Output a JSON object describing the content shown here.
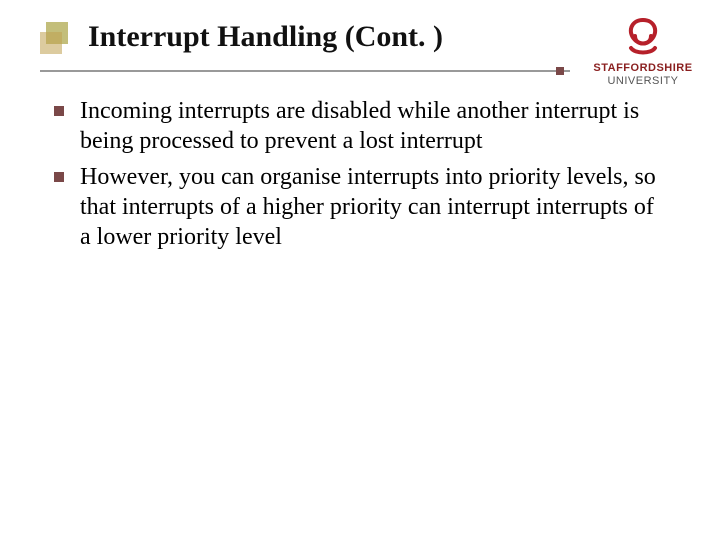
{
  "brand": {
    "name_line1": "STAFFORDSHIRE",
    "name_line2": "UNIVERSITY",
    "icon_color": "#b6202a",
    "icon_name": "staffordshire-knot"
  },
  "title": "Interrupt Handling (Cont. )",
  "bullets": [
    "Incoming interrupts are disabled while another interrupt is being processed to prevent a lost interrupt",
    "However, you can organise interrupts into priority levels, so that interrupts of a higher priority can interrupt interrupts of a lower priority level"
  ]
}
